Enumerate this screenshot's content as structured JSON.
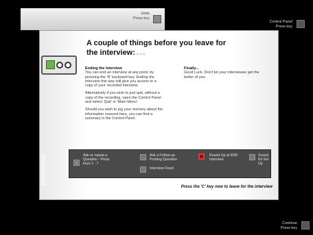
{
  "hints": {
    "line1": "Hints",
    "line2": "Press key",
    "key": ""
  },
  "control_panel": {
    "line1": "Control Panel",
    "line2": "Press key",
    "key": ""
  },
  "page": {
    "title_line1": "A couple of things before you leave for",
    "title_line2": "the interview:",
    "title_small": "(1 of 1)",
    "left": {
      "heading": "Ending the Interview",
      "p1": "You can end an interview at any point, by pressing the 'R' keyboard key. Ending the interview this way will give you access to a copy of your recorded interview.",
      "p2": "Alternatively if you wish to just quit, without a copy of the recording, open the Control Panel and select 'Quit' or 'Main Menu'.",
      "p3": "Should you wish to jog your memory about the information covered here, you can find a summary in the Control Panel."
    },
    "right": {
      "heading": "Finally...",
      "p1": "Good Luck. Don't let your interviewee get the better of you."
    },
    "menu": {
      "k1": "1",
      "ask": "Ask or repeat a Question - Press keys 1 - 7",
      "k2": "",
      "followup": "Ask a Follow-up Probing Question",
      "k3": "",
      "interview_fixed": "Interview Fixed",
      "k4": "",
      "roundup": "Round Up at END Interview",
      "k5": "",
      "soundkit": "Sound Kit Set Up"
    },
    "bottom_note": "Press the 'C' key now to leave for the interview"
  },
  "continue": {
    "line1": "Continue",
    "line2": "Press key",
    "key": ""
  }
}
